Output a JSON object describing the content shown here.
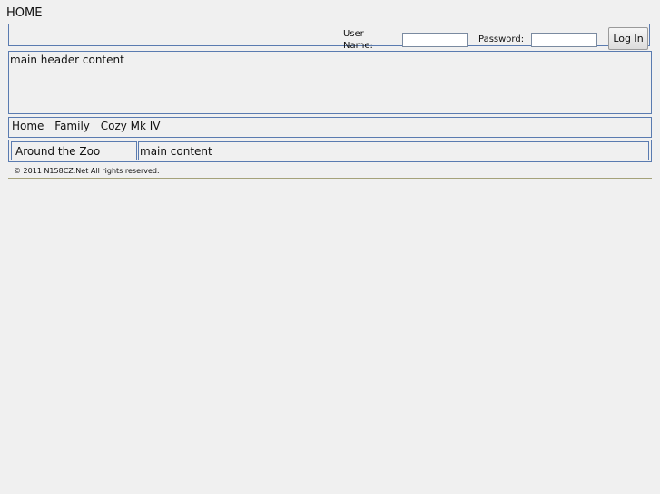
{
  "page": {
    "title": "HOME"
  },
  "login": {
    "user_label": "User Name:",
    "user_value": "",
    "password_label": "Password:",
    "password_value": "",
    "button_label": "Log In"
  },
  "header": {
    "text": "main header content"
  },
  "nav": {
    "items": [
      {
        "label": "Home"
      },
      {
        "label": "Family"
      },
      {
        "label": "Cozy Mk IV"
      }
    ]
  },
  "sidebar": {
    "text": "Around the Zoo"
  },
  "main": {
    "text": "main content"
  },
  "footer": {
    "text": "© 2011 N158CZ.Net All rights reserved."
  },
  "colors": {
    "background": "#f0f0f0",
    "border": "#5a7bb0",
    "footer_rule": "#a5a27a"
  }
}
